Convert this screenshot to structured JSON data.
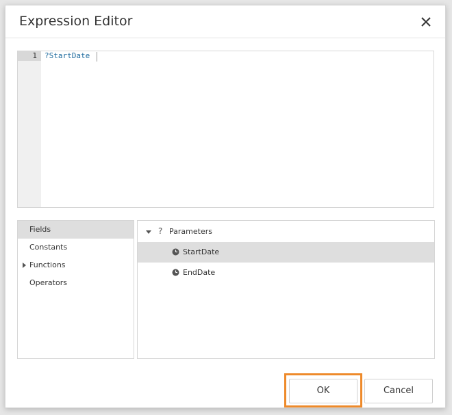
{
  "dialog": {
    "title": "Expression Editor",
    "close_icon": "close-icon"
  },
  "editor": {
    "line_number": "1",
    "code": "?StartDate"
  },
  "categories": [
    {
      "label": "Fields",
      "selected": true,
      "expandable": false
    },
    {
      "label": "Constants",
      "selected": false,
      "expandable": false
    },
    {
      "label": "Functions",
      "selected": false,
      "expandable": true
    },
    {
      "label": "Operators",
      "selected": false,
      "expandable": false
    }
  ],
  "tree": {
    "parent": {
      "label": "Parameters",
      "icon": "parameter-icon",
      "glyph": "?",
      "expanded": true
    },
    "children": [
      {
        "label": "StartDate",
        "icon": "clock-icon",
        "selected": true
      },
      {
        "label": "EndDate",
        "icon": "clock-icon",
        "selected": false
      }
    ]
  },
  "buttons": {
    "ok_label": "OK",
    "cancel_label": "Cancel"
  },
  "colors": {
    "highlight": "#ee8a2a",
    "selection": "#dedede",
    "code_text": "#1e6b9e"
  }
}
